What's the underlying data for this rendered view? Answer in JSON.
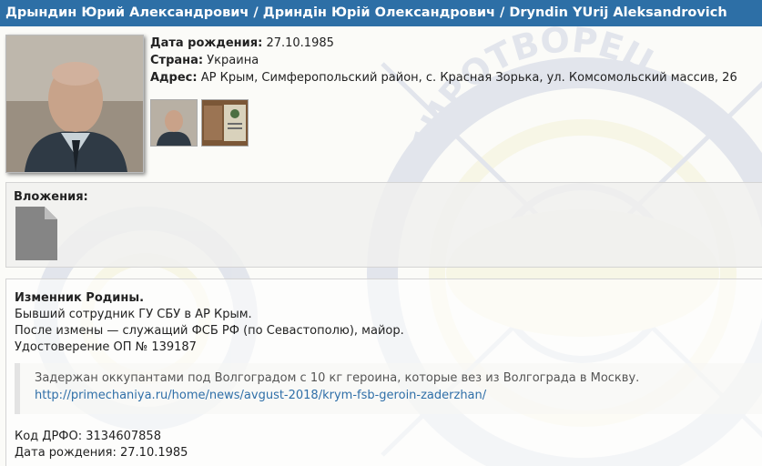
{
  "header": {
    "title": "Дрындин Юрий Александрович / Дриндін Юрій Олександрович / Dryndin YUrij Aleksandrovich"
  },
  "profile": {
    "birth_label": "Дата рождения:",
    "birth_value": "27.10.1985",
    "country_label": "Страна:",
    "country_value": "Украина",
    "address_label": "Адрес:",
    "address_value": "АР Крым, Симферопольский район, с. Красная Зорька, ул. Комсомольский массив, 26"
  },
  "attachments": {
    "title": "Вложения:"
  },
  "description": {
    "heading": "Изменник Родины.",
    "line1": "Бывший сотрудник ГУ СБУ в АР Крым.",
    "line2": "После измены — служащий ФСБ РФ (по Севастополю), майор.",
    "line3": "Удостоверение ОП № 139187",
    "quote_text": "Задержан оккупантами под Волгоградом с 10 кг героина, которые вез из Волгограда в Москву.",
    "quote_link": "http://primechaniya.ru/home/news/avgust-2018/krym-fsb-geroin-zaderzhan/",
    "drfo_label": "Код ДРФО:",
    "drfo_value": "3134607858",
    "birth_label": "Дата рождения:",
    "birth_value": "27.10.1985"
  },
  "watermark": {
    "text": "МИРОТВОРЕЦ"
  },
  "colors": {
    "header": "#2d6fa6",
    "link": "#2f6fa8",
    "watermark_blue": "#233f8f",
    "watermark_yellow": "#d8cf5f"
  }
}
